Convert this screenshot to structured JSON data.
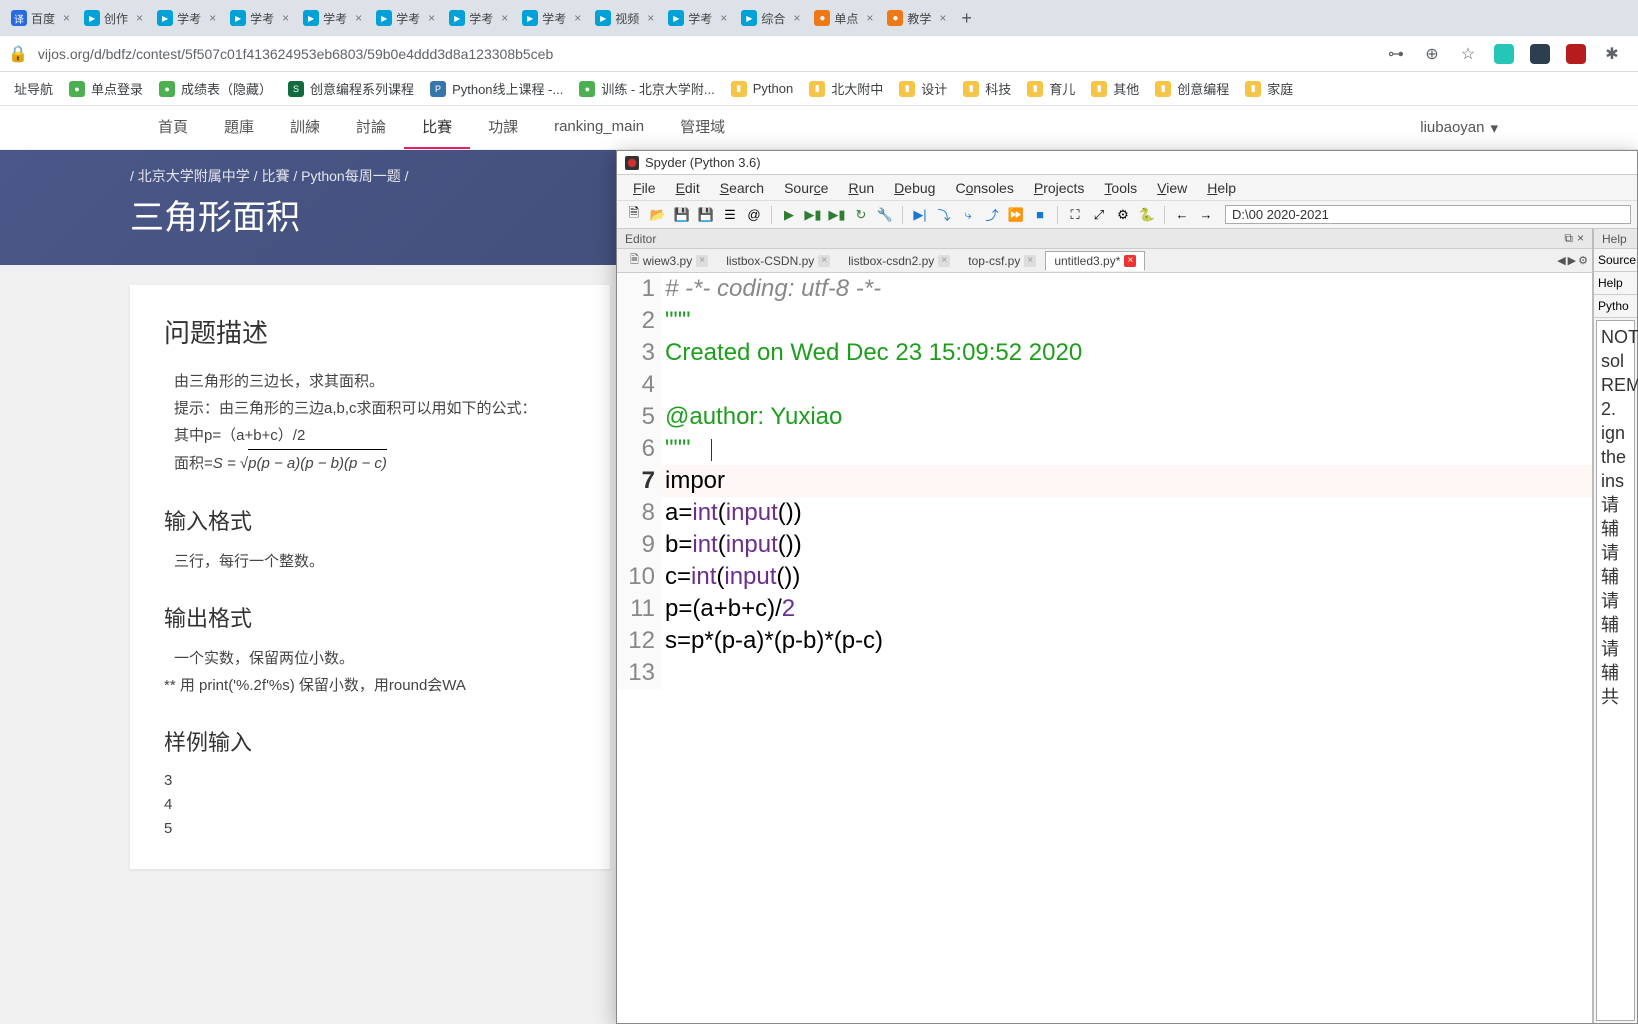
{
  "browser": {
    "tabs": [
      {
        "label": "百度"
      },
      {
        "label": "创作"
      },
      {
        "label": "学考"
      },
      {
        "label": "学考"
      },
      {
        "label": "学考"
      },
      {
        "label": "学考"
      },
      {
        "label": "学考"
      },
      {
        "label": "学考"
      },
      {
        "label": "视频"
      },
      {
        "label": "学考"
      },
      {
        "label": "综合"
      },
      {
        "label": "单点"
      },
      {
        "label": "教学"
      }
    ],
    "url": "vijos.org/d/bdfz/contest/5f507c01f413624953eb6803/59b0e4ddd3d8a123308b5ceb"
  },
  "bookmarks": [
    {
      "label": "址导航"
    },
    {
      "label": "单点登录"
    },
    {
      "label": "成绩表（隐藏）"
    },
    {
      "label": "创意编程系列课程"
    },
    {
      "label": "Python线上课程 -..."
    },
    {
      "label": "训练 - 北京大学附..."
    },
    {
      "label": "Python"
    },
    {
      "label": "北大附中"
    },
    {
      "label": "设计"
    },
    {
      "label": "科技"
    },
    {
      "label": "育儿"
    },
    {
      "label": "其他"
    },
    {
      "label": "创意编程"
    },
    {
      "label": "家庭"
    }
  ],
  "nav": {
    "items": [
      "首頁",
      "題庫",
      "訓練",
      "討論",
      "比賽",
      "功課",
      "ranking_main",
      "管理域"
    ],
    "active_index": 4,
    "user": "liubaoyan"
  },
  "page": {
    "breadcrumb": "/ 北京大学附属中学 / 比賽 / Python每周一题 /",
    "title": "三角形面积"
  },
  "problem": {
    "desc_heading": "问题描述",
    "desc_lines": [
      "由三角形的三边长，求其面积。",
      "提示：由三角形的三边a,b,c求面积可以用如下的公式：",
      "其中p=（a+b+c）/2",
      "面积="
    ],
    "formula_S": "S = ",
    "formula_sqrt": "√",
    "formula_body": "p(p − a)(p − b)(p − c)",
    "input_heading": "输入格式",
    "input_text": "三行，每行一个整数。",
    "output_heading": "输出格式",
    "output_text1": "一个实数，保留两位小数。",
    "output_text2": "** 用 print('%.2f'%s) 保留小数，用round会WA",
    "sample_in_heading": "样例输入",
    "sample_in": [
      "3",
      "4",
      "5"
    ]
  },
  "spyder": {
    "title": "Spyder (Python 3.6)",
    "menus": [
      "File",
      "Edit",
      "Search",
      "Source",
      "Run",
      "Debug",
      "Consoles",
      "Projects",
      "Tools",
      "View",
      "Help"
    ],
    "path": "D:\\00 2020-2021",
    "editor_label": "Editor",
    "help_label": "Help",
    "source_label": "Source",
    "python_label": "Pytho",
    "file_tabs": [
      {
        "name": "wiew3.py"
      },
      {
        "name": "listbox-CSDN.py"
      },
      {
        "name": "listbox-csdn2.py"
      },
      {
        "name": "top-csf.py"
      },
      {
        "name": "untitled3.py*",
        "active": true
      }
    ],
    "code": {
      "l1": "# -*- coding: utf-8 -*-",
      "l2": "\"\"\"",
      "l3": "Created on Wed Dec 23 15:09:52 2020",
      "l4": "",
      "l5": "@author: Yuxiao",
      "l6": "\"\"\"",
      "l7": "impor",
      "l8a": "a=",
      "l8b": "int",
      "l8c": "(",
      "l8d": "input",
      "l8e": "())",
      "l9a": "b=",
      "l9b": "int",
      "l9c": "(",
      "l9d": "input",
      "l9e": "())",
      "l10a": "c=",
      "l10b": "int",
      "l10c": "(",
      "l10d": "input",
      "l10e": "())",
      "l11a": "p=(a+b+c)/",
      "l11b": "2",
      "l12": "s=p*(p-a)*(p-b)*(p-c)"
    },
    "help": {
      "lines": [
        "NOT",
        "sol",
        "REM",
        "2.",
        "ign",
        "the",
        "ins",
        "",
        "请辅",
        "请辅",
        "请辅",
        "请辅",
        "共"
      ]
    }
  }
}
